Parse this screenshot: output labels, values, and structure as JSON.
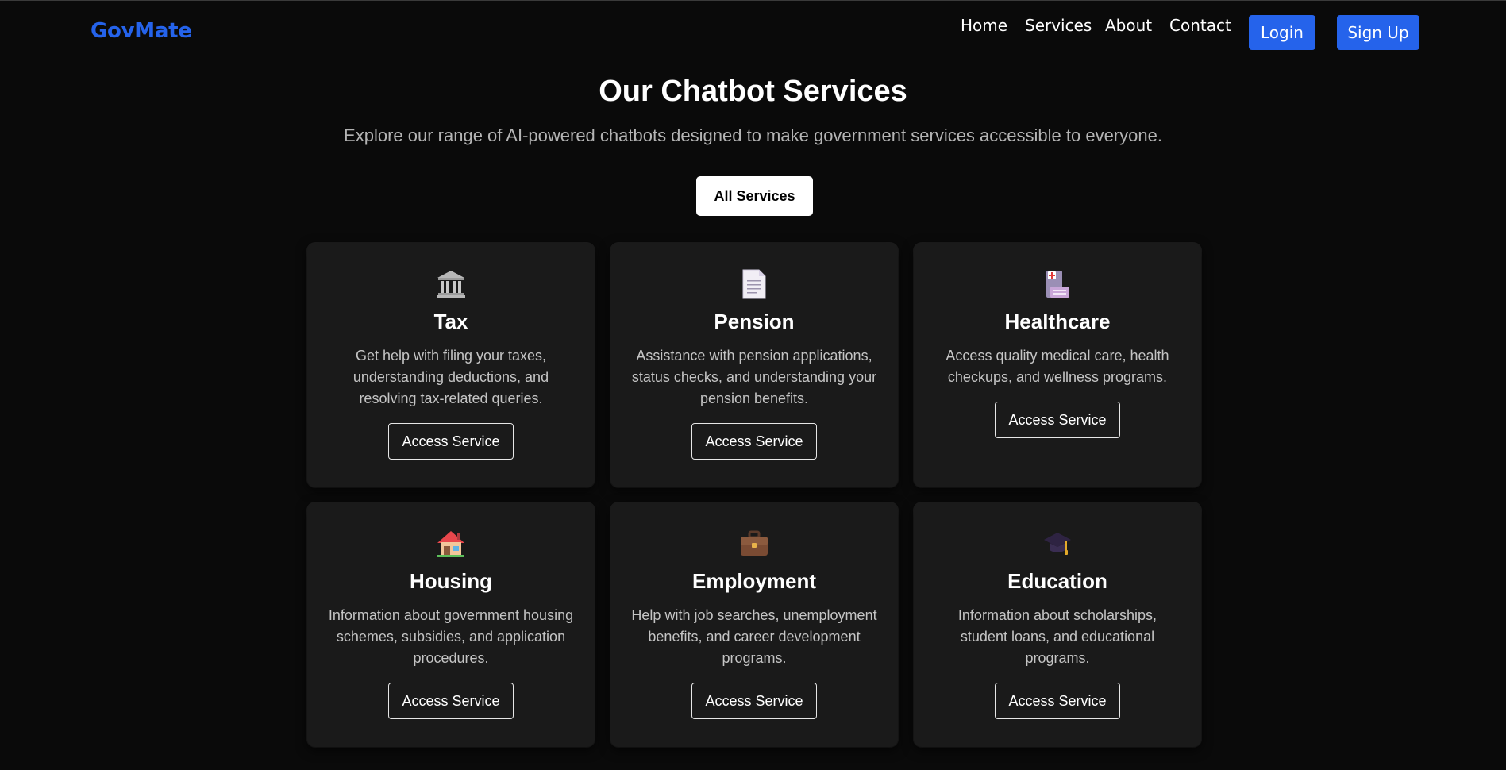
{
  "brand": {
    "name": "GovMate",
    "color": "#2563eb"
  },
  "nav": {
    "links": [
      "Home",
      "Services",
      "About",
      "Contact"
    ],
    "login": "Login",
    "signup": "Sign Up"
  },
  "hero": {
    "title": "Our Chatbot Services",
    "subtitle": "Explore our range of AI-powered chatbots designed to make government services accessible to everyone."
  },
  "filter": {
    "label": "All Services"
  },
  "services": [
    {
      "icon": "bank-icon",
      "title": "Tax",
      "description": "Get help with filing your taxes, understanding deductions, and resolving tax-related queries.",
      "button": "Access Service"
    },
    {
      "icon": "document-icon",
      "title": "Pension",
      "description": "Assistance with pension applications, status checks, and understanding your pension benefits.",
      "button": "Access Service"
    },
    {
      "icon": "hospital-icon",
      "title": "Healthcare",
      "description": "Access quality medical care, health checkups, and wellness programs.",
      "button": "Access Service"
    },
    {
      "icon": "house-icon",
      "title": "Housing",
      "description": "Information about government housing schemes, subsidies, and application procedures.",
      "button": "Access Service"
    },
    {
      "icon": "briefcase-icon",
      "title": "Employment",
      "description": "Help with job searches, unemployment benefits, and career development programs.",
      "button": "Access Service"
    },
    {
      "icon": "graduation-cap-icon",
      "title": "Education",
      "description": "Information about scholarships, student loans, and educational programs.",
      "button": "Access Service"
    }
  ]
}
